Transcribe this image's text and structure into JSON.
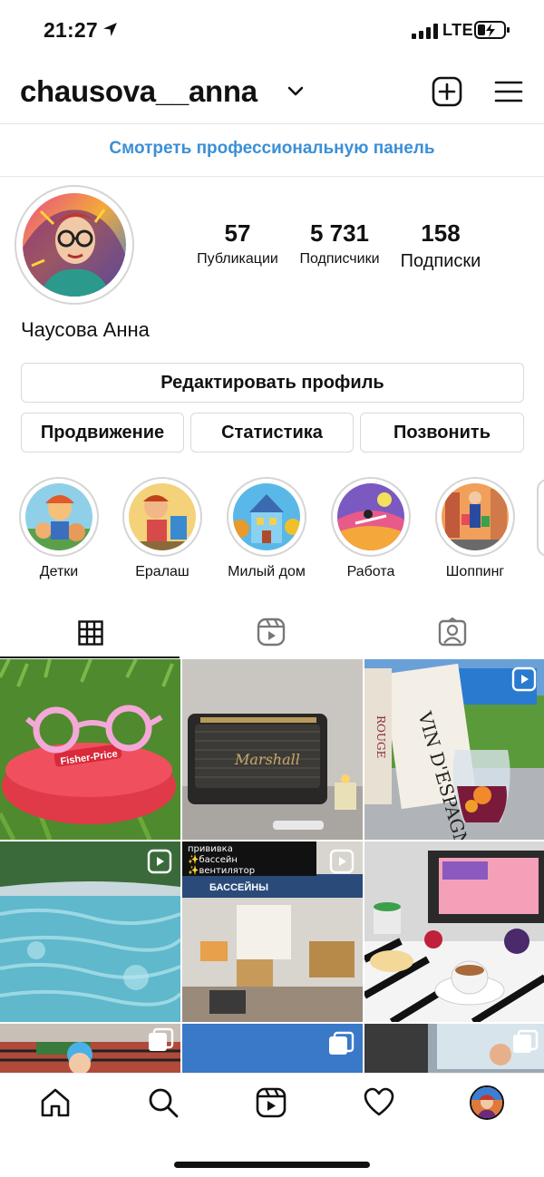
{
  "status": {
    "time": "21:27",
    "network": "LTE"
  },
  "header": {
    "username": "chausova__anna"
  },
  "pro_panel": {
    "label": "Смотреть профессиональную панель"
  },
  "profile": {
    "full_name": "Чаусова Анна",
    "stats": [
      {
        "value": "57",
        "label": "Публикации"
      },
      {
        "value": "5 731",
        "label": "Подписчики"
      },
      {
        "value": "158",
        "label": "Подписки"
      }
    ]
  },
  "buttons": {
    "edit_profile": "Редактировать профиль",
    "promote": "Продвижение",
    "statistics": "Статистика",
    "call": "Позвонить"
  },
  "highlights": [
    {
      "label": "Детки"
    },
    {
      "label": "Ералаш"
    },
    {
      "label": "Милый дом"
    },
    {
      "label": "Работа"
    },
    {
      "label": "Шоппинг"
    }
  ],
  "grid_posts": {
    "post3_text": [
      "VIN D'ESPAGNE",
      "ROUGE"
    ],
    "post5_caption": [
      "прививка",
      "✨бассейн",
      "✨вентилятор"
    ],
    "post5_sign": "БАССЕЙНЫ",
    "post2_brand": "Marshall",
    "post1_brand": "Fisher-Price"
  },
  "colors": {
    "accent_link": "#3b8fd6",
    "text": "#111111",
    "border": "#d9d9d9"
  }
}
